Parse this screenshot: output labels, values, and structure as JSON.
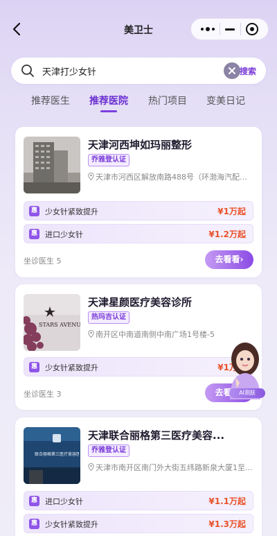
{
  "nav": {
    "title": "美卫士"
  },
  "search": {
    "query": "天津打少女针",
    "button_label": "搜索"
  },
  "tabs": [
    {
      "label": "推荐医生",
      "active": false
    },
    {
      "label": "推荐医院",
      "active": true
    },
    {
      "label": "热门项目",
      "active": false
    },
    {
      "label": "变美日记",
      "active": false
    }
  ],
  "hospitals": [
    {
      "name": "天津河西坤如玛丽整形",
      "cert": "乔雅登认证",
      "address": "天津市河西区解放南路488号（环渤海汽配城...",
      "items": [
        {
          "badge": "惠",
          "name": "少女针紧致提升",
          "price": "¥1万起"
        },
        {
          "badge": "惠",
          "name": "进口少女针",
          "price": "¥1.2万起"
        }
      ],
      "doctors": "坐诊医生 5",
      "button": "去看看›"
    },
    {
      "name": "天津星颜医疗美容诊所",
      "cert": "热玛吉认证",
      "address": "南开区中南道南侧中南广场1号楼-5",
      "thumb_text": "STARS AVENUE",
      "items": [
        {
          "badge": "惠",
          "name": "少女针紧致提升",
          "price": "¥1万起"
        }
      ],
      "doctors": "坐诊医生 3",
      "button": "去看看›"
    },
    {
      "name": "天津联合丽格第三医疗美容...",
      "cert": "乔雅登认证",
      "address": "天津市南开区南门外大街五纬路新泉大厦1至...",
      "thumb_text": "联合丽格第三医疗美容医院",
      "items": [
        {
          "badge": "惠",
          "name": "进口少女针",
          "price": "¥1.1万起"
        },
        {
          "badge": "惠",
          "name": "少女针紧致提升",
          "price": "¥1.3万起"
        }
      ]
    }
  ],
  "ai_assistant": {
    "label": "AI测肤"
  },
  "colors": {
    "accent": "#7a3cd8",
    "price": "#e9522a",
    "badge": "#8f54e8"
  }
}
